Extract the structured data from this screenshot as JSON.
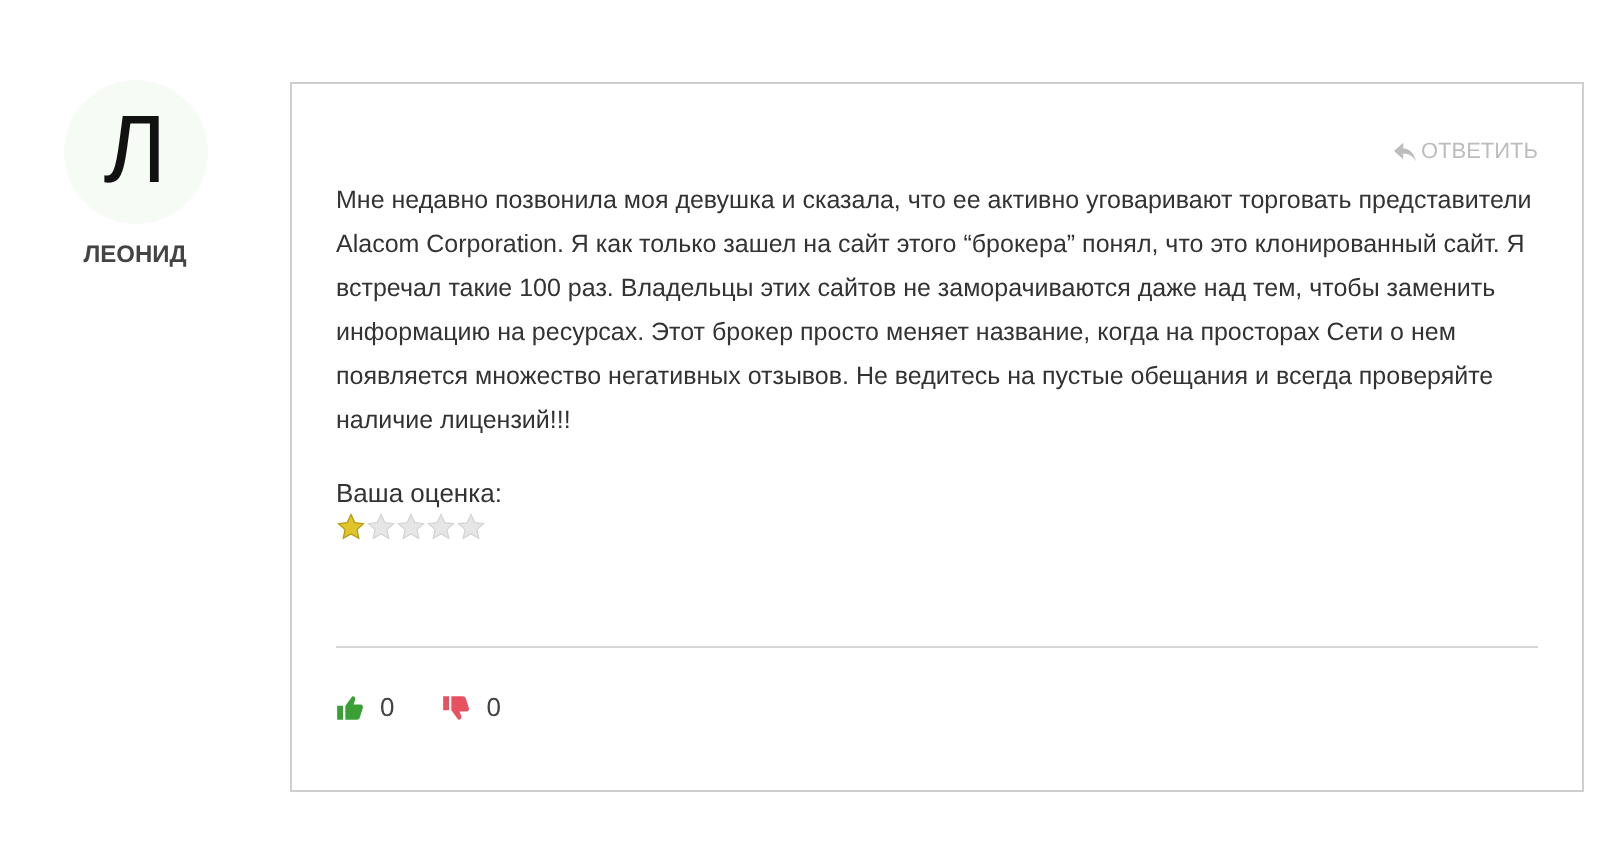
{
  "author": {
    "initial": "Л",
    "name": "ЛЕОНИД"
  },
  "comment": {
    "reply": "ОТВЕТИТЬ",
    "text": "Мне недавно позвонила моя девушка и сказала, что ее активно уговаривают торговать представители Alacom Corporation. Я как только зашел на сайт этого “брокера” понял, что это клонированный сайт. Я встречал такие 100 раз. Владельцы этих сайтов не заморачиваются даже над тем, чтобы заменить информацию на ресурсах. Этот брокер просто меняет название, когда на просторах Сети о нем появляется множество негативных отзывов. Не ведитесь на пустые обещания и всегда проверяйте наличие лицензий!!!",
    "rating_label": "Ваша оценка:",
    "stars": 1,
    "likes": "0",
    "dislikes": "0"
  }
}
